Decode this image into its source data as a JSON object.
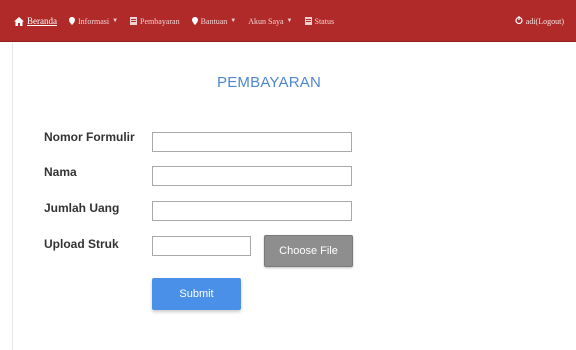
{
  "navbar": {
    "background": "#b02a2a",
    "items": [
      {
        "label": "Beranda",
        "icon": "home-icon",
        "active": true,
        "dropdown": false
      },
      {
        "label": "Informasi",
        "icon": "pin-icon",
        "active": false,
        "dropdown": true
      },
      {
        "label": "Pembayaran",
        "icon": "document-icon",
        "active": false,
        "dropdown": false
      },
      {
        "label": "Bantuan",
        "icon": "pin-icon",
        "active": false,
        "dropdown": true
      },
      {
        "label": "Akun Saya",
        "icon": "",
        "active": false,
        "dropdown": true
      },
      {
        "label": "Status",
        "icon": "document-icon",
        "active": false,
        "dropdown": false
      }
    ],
    "logout": {
      "label": "adi(Logout)",
      "icon": "power-icon"
    }
  },
  "main": {
    "title": "PEMBAYARAN",
    "title_color": "#4f88cf",
    "fields": [
      {
        "label": "Nomor Formulir",
        "value": "",
        "placeholder": ""
      },
      {
        "label": "Nama",
        "value": "",
        "placeholder": ""
      },
      {
        "label": "Jumlah Uang",
        "value": "",
        "placeholder": ""
      },
      {
        "label": "Upload Struk",
        "value": "",
        "placeholder": ""
      }
    ],
    "choose_file_label": "Choose File",
    "submit_label": "Submit",
    "submit_color": "#4a8fe8"
  }
}
